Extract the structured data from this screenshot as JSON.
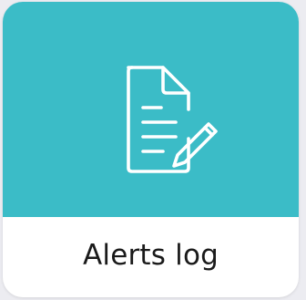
{
  "tile": {
    "label": "Alerts log",
    "icon": "document-edit-icon",
    "accent_color": "#3bbcc7"
  }
}
